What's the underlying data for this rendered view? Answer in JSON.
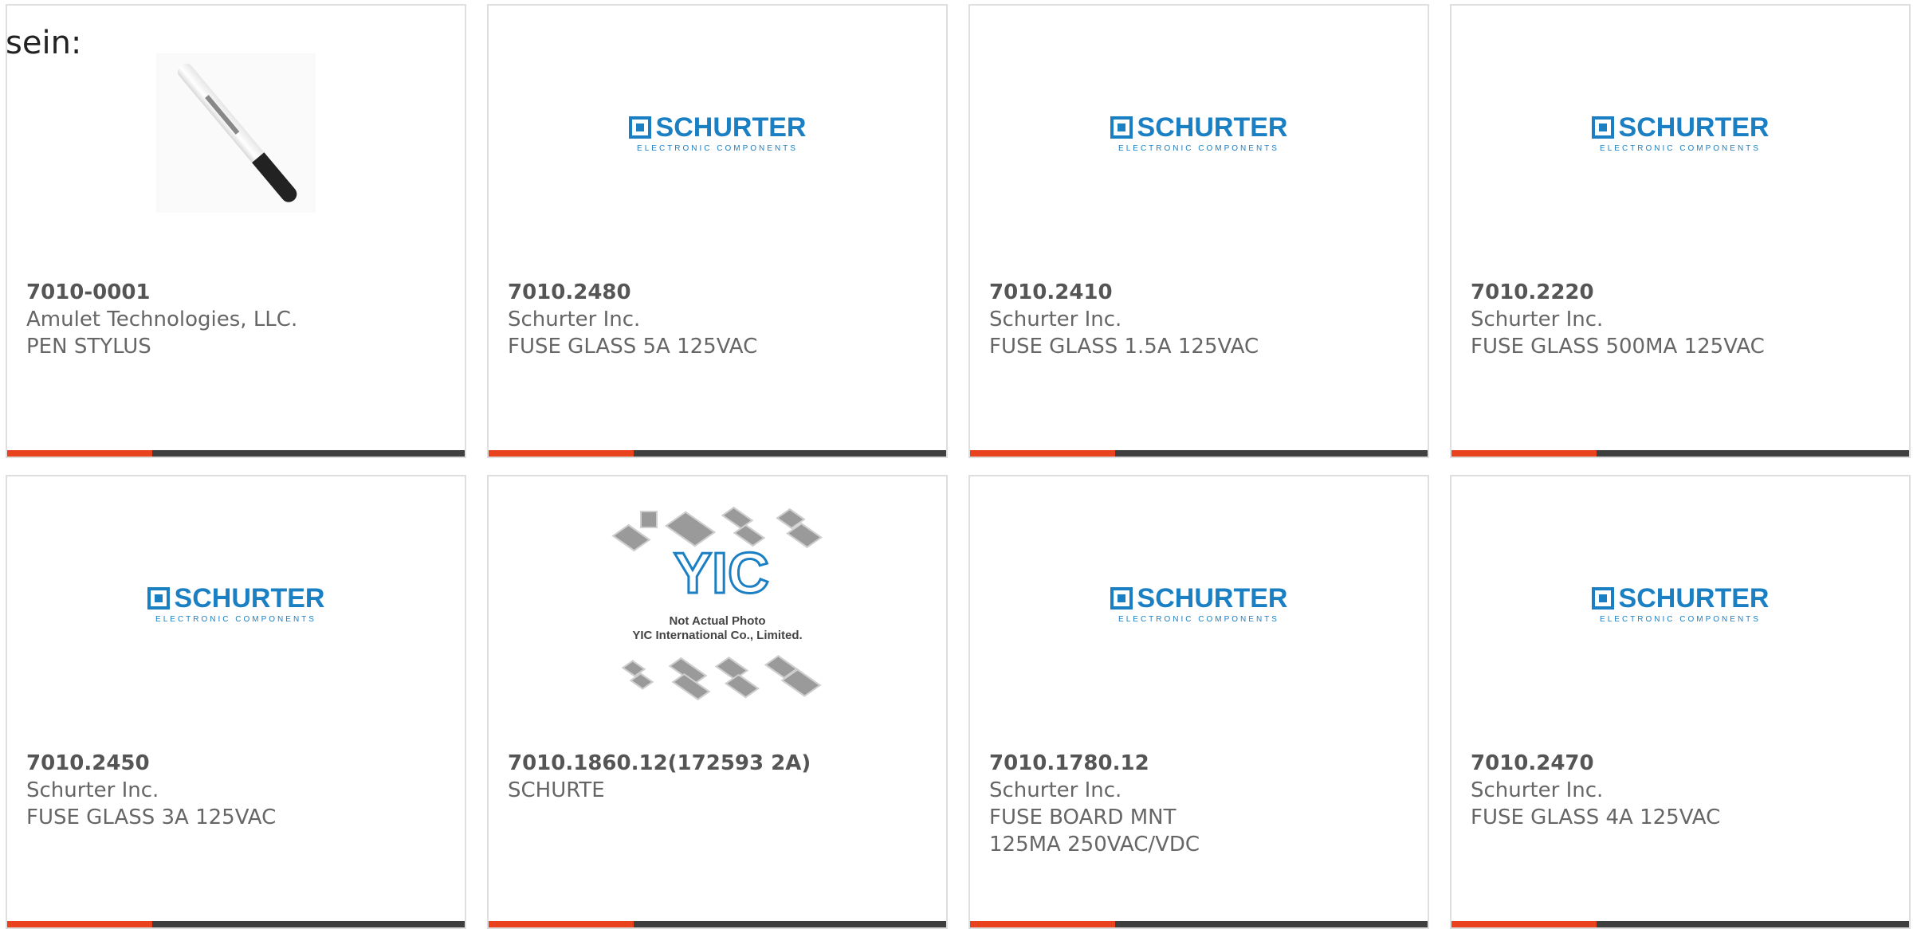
{
  "intro_text": "sein:",
  "logo": {
    "schurter_word": "SCHURTER",
    "schurter_sub": "ELECTRONIC COMPONENTS",
    "yic_word": "YIC",
    "yic_caption_1": "Not Actual Photo",
    "yic_caption_2": "YIC International Co., Limited."
  },
  "colors": {
    "accent": "#e8421e",
    "bar": "#3f3f3f",
    "schurter_blue": "#1b7fc3"
  },
  "products": [
    {
      "part_number": "7010-0001",
      "manufacturer": "Amulet Technologies, LLC.",
      "description": "PEN STYLUS",
      "image": "pen-stylus-photo"
    },
    {
      "part_number": "7010.2480",
      "manufacturer": "Schurter Inc.",
      "description": "FUSE GLASS 5A 125VAC",
      "image": "schurter-logo"
    },
    {
      "part_number": "7010.2410",
      "manufacturer": "Schurter Inc.",
      "description": "FUSE GLASS 1.5A 125VAC",
      "image": "schurter-logo"
    },
    {
      "part_number": "7010.2220",
      "manufacturer": "Schurter Inc.",
      "description": "FUSE GLASS 500MA 125VAC",
      "image": "schurter-logo"
    },
    {
      "part_number": "7010.2450",
      "manufacturer": "Schurter Inc.",
      "description": "FUSE GLASS 3A 125VAC",
      "image": "schurter-logo"
    },
    {
      "part_number": "7010.1860.12(172593 2A)",
      "manufacturer": "SCHURTE",
      "description": "",
      "image": "yic-not-actual-photo"
    },
    {
      "part_number": "7010.1780.12",
      "manufacturer": "Schurter Inc.",
      "description": "FUSE BOARD MNT 125MA 250VAC/VDC",
      "image": "schurter-logo"
    },
    {
      "part_number": "7010.2470",
      "manufacturer": "Schurter Inc.",
      "description": "FUSE GLASS 4A 125VAC",
      "image": "schurter-logo"
    }
  ]
}
